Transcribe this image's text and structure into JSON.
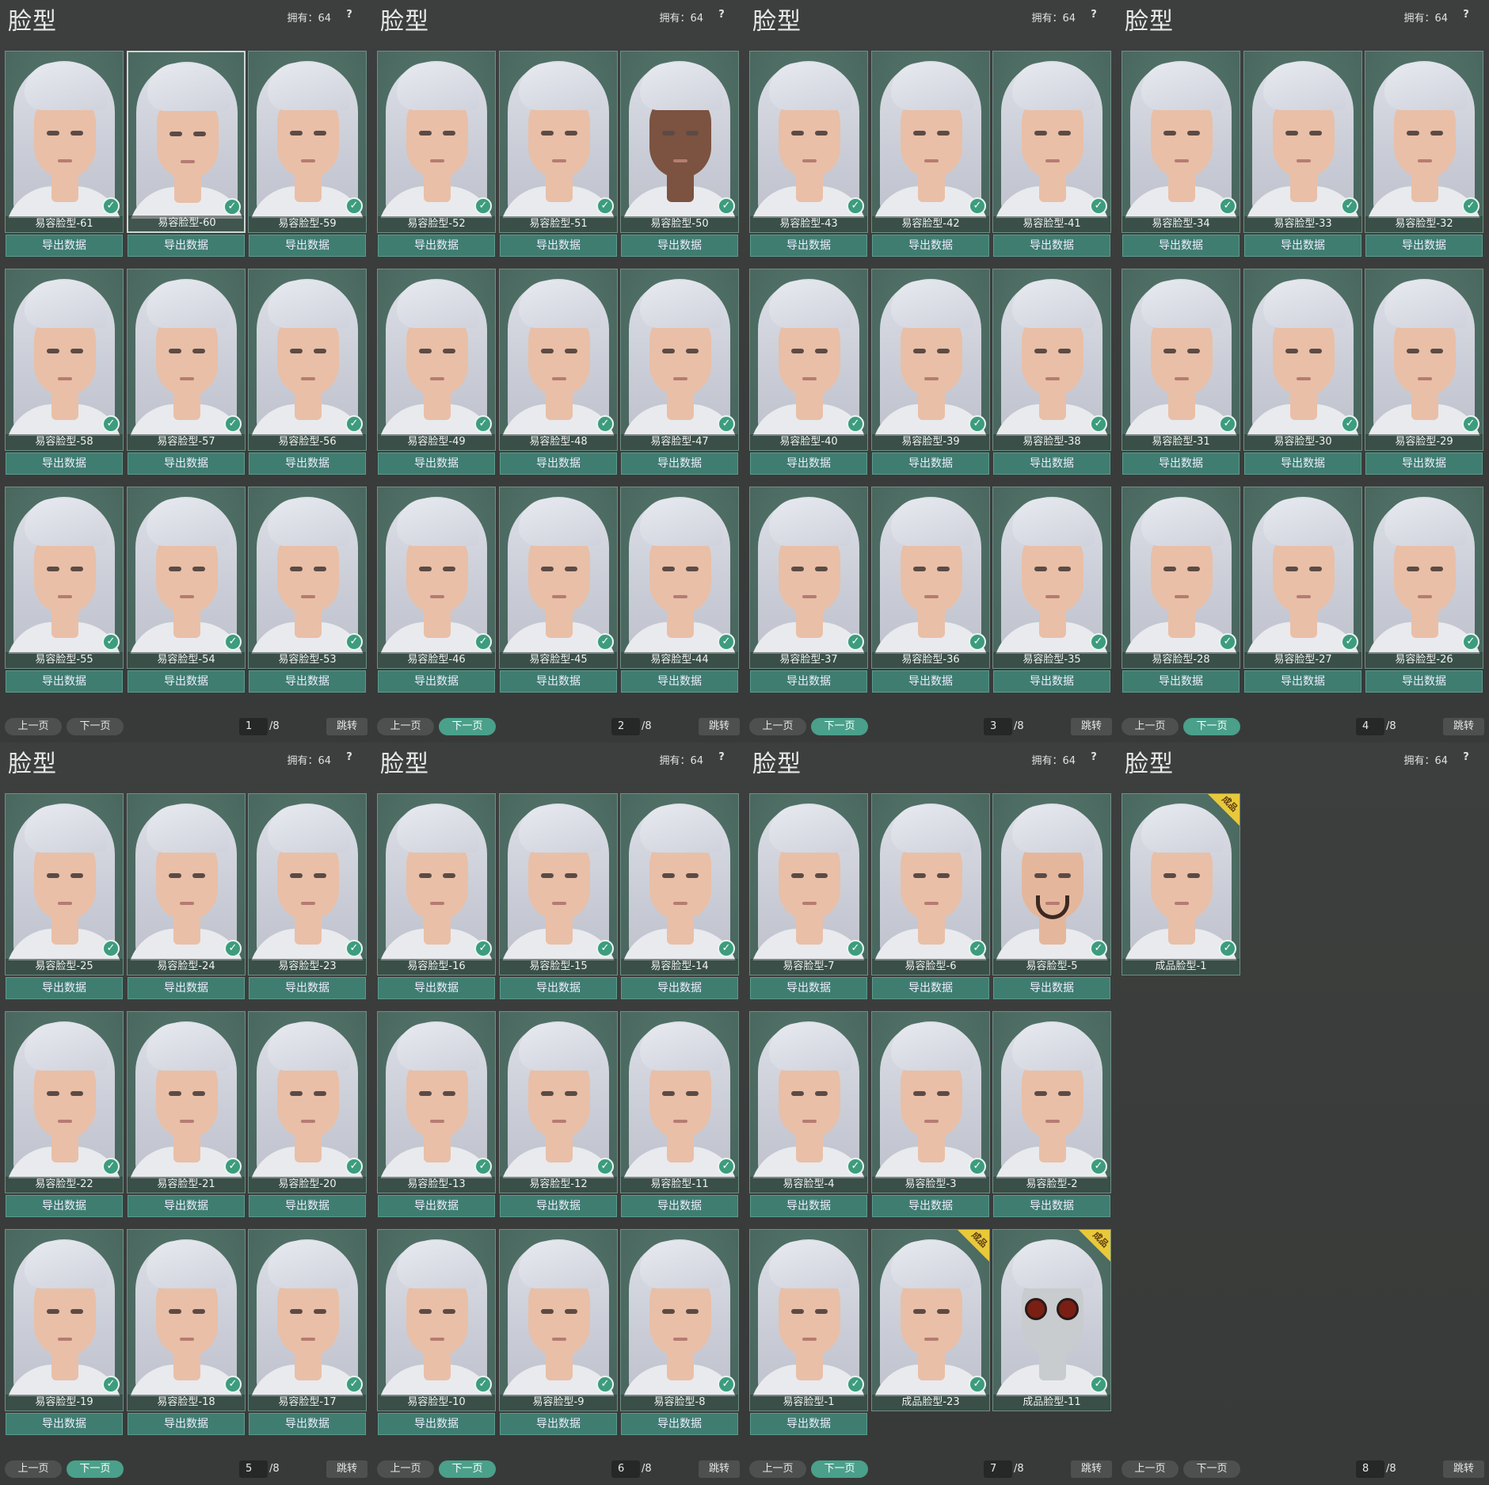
{
  "app": {
    "export_label": "导出数据",
    "prev_label": "上一页",
    "next_label": "下一页",
    "jump_label": "跳转",
    "owned_label": "拥有：64",
    "help_label": "?",
    "page_total": "/8",
    "badge_label": "成品",
    "check_glyph": "✓"
  },
  "colors": {
    "card_bg": "#4f6f65",
    "button_bg": "#3f7d70",
    "page_bg": "#3a3c3b",
    "accent": "#4aa08a",
    "badge": "#e8c93a"
  },
  "panels": [
    {
      "title": "脸型",
      "page": "1",
      "next_active": false,
      "cards": [
        {
          "label": "易容脸型-61",
          "selected": false,
          "tone": "light",
          "badge": false,
          "export": true
        },
        {
          "label": "易容脸型-60",
          "selected": true,
          "tone": "light",
          "badge": false,
          "export": true
        },
        {
          "label": "易容脸型-59",
          "selected": false,
          "tone": "light",
          "badge": false,
          "export": true
        },
        {
          "label": "易容脸型-58",
          "selected": false,
          "tone": "light",
          "badge": false,
          "export": true
        },
        {
          "label": "易容脸型-57",
          "selected": false,
          "tone": "light",
          "badge": false,
          "export": true
        },
        {
          "label": "易容脸型-56",
          "selected": false,
          "tone": "light",
          "badge": false,
          "export": true
        },
        {
          "label": "易容脸型-55",
          "selected": false,
          "tone": "light",
          "badge": false,
          "export": true
        },
        {
          "label": "易容脸型-54",
          "selected": false,
          "tone": "light",
          "badge": false,
          "export": true
        },
        {
          "label": "易容脸型-53",
          "selected": false,
          "tone": "light",
          "badge": false,
          "export": true
        }
      ]
    },
    {
      "title": "脸型",
      "page": "2",
      "next_active": true,
      "cards": [
        {
          "label": "易容脸型-52",
          "selected": false,
          "tone": "light",
          "badge": false,
          "export": true
        },
        {
          "label": "易容脸型-51",
          "selected": false,
          "tone": "light",
          "badge": false,
          "export": true
        },
        {
          "label": "易容脸型-50",
          "selected": false,
          "tone": "dark",
          "badge": false,
          "export": true
        },
        {
          "label": "易容脸型-49",
          "selected": false,
          "tone": "light",
          "badge": false,
          "export": true
        },
        {
          "label": "易容脸型-48",
          "selected": false,
          "tone": "light",
          "badge": false,
          "export": true
        },
        {
          "label": "易容脸型-47",
          "selected": false,
          "tone": "light",
          "badge": false,
          "export": true
        },
        {
          "label": "易容脸型-46",
          "selected": false,
          "tone": "light",
          "badge": false,
          "export": true
        },
        {
          "label": "易容脸型-45",
          "selected": false,
          "tone": "light",
          "badge": false,
          "export": true
        },
        {
          "label": "易容脸型-44",
          "selected": false,
          "tone": "light",
          "badge": false,
          "export": true
        }
      ]
    },
    {
      "title": "脸型",
      "page": "3",
      "next_active": true,
      "cards": [
        {
          "label": "易容脸型-43",
          "selected": false,
          "tone": "light",
          "badge": false,
          "export": true
        },
        {
          "label": "易容脸型-42",
          "selected": false,
          "tone": "light",
          "badge": false,
          "export": true
        },
        {
          "label": "易容脸型-41",
          "selected": false,
          "tone": "light",
          "badge": false,
          "export": true
        },
        {
          "label": "易容脸型-40",
          "selected": false,
          "tone": "light",
          "badge": false,
          "export": true
        },
        {
          "label": "易容脸型-39",
          "selected": false,
          "tone": "light",
          "badge": false,
          "export": true
        },
        {
          "label": "易容脸型-38",
          "selected": false,
          "tone": "light",
          "badge": false,
          "export": true
        },
        {
          "label": "易容脸型-37",
          "selected": false,
          "tone": "light",
          "badge": false,
          "export": true
        },
        {
          "label": "易容脸型-36",
          "selected": false,
          "tone": "light",
          "badge": false,
          "export": true
        },
        {
          "label": "易容脸型-35",
          "selected": false,
          "tone": "light",
          "badge": false,
          "export": true
        }
      ]
    },
    {
      "title": "脸型",
      "page": "4",
      "next_active": true,
      "cards": [
        {
          "label": "易容脸型-34",
          "selected": false,
          "tone": "light",
          "badge": false,
          "export": true
        },
        {
          "label": "易容脸型-33",
          "selected": false,
          "tone": "light",
          "badge": false,
          "export": true
        },
        {
          "label": "易容脸型-32",
          "selected": false,
          "tone": "light",
          "badge": false,
          "export": true
        },
        {
          "label": "易容脸型-31",
          "selected": false,
          "tone": "light",
          "badge": false,
          "export": true
        },
        {
          "label": "易容脸型-30",
          "selected": false,
          "tone": "light",
          "badge": false,
          "export": true
        },
        {
          "label": "易容脸型-29",
          "selected": false,
          "tone": "light",
          "badge": false,
          "export": true
        },
        {
          "label": "易容脸型-28",
          "selected": false,
          "tone": "light",
          "badge": false,
          "export": true
        },
        {
          "label": "易容脸型-27",
          "selected": false,
          "tone": "light",
          "badge": false,
          "export": true
        },
        {
          "label": "易容脸型-26",
          "selected": false,
          "tone": "light",
          "badge": false,
          "export": true
        }
      ]
    },
    {
      "title": "脸型",
      "page": "5",
      "next_active": true,
      "cards": [
        {
          "label": "易容脸型-25",
          "selected": false,
          "tone": "light",
          "badge": false,
          "export": true
        },
        {
          "label": "易容脸型-24",
          "selected": false,
          "tone": "light",
          "badge": false,
          "export": true
        },
        {
          "label": "易容脸型-23",
          "selected": false,
          "tone": "light",
          "badge": false,
          "export": true
        },
        {
          "label": "易容脸型-22",
          "selected": false,
          "tone": "light",
          "badge": false,
          "export": true
        },
        {
          "label": "易容脸型-21",
          "selected": false,
          "tone": "light",
          "badge": false,
          "export": true
        },
        {
          "label": "易容脸型-20",
          "selected": false,
          "tone": "light",
          "badge": false,
          "export": true
        },
        {
          "label": "易容脸型-19",
          "selected": false,
          "tone": "light",
          "badge": false,
          "export": true
        },
        {
          "label": "易容脸型-18",
          "selected": false,
          "tone": "light",
          "badge": false,
          "export": true
        },
        {
          "label": "易容脸型-17",
          "selected": false,
          "tone": "light",
          "badge": false,
          "export": true
        }
      ]
    },
    {
      "title": "脸型",
      "page": "6",
      "next_active": true,
      "cards": [
        {
          "label": "易容脸型-16",
          "selected": false,
          "tone": "light",
          "badge": false,
          "export": true
        },
        {
          "label": "易容脸型-15",
          "selected": false,
          "tone": "light",
          "badge": false,
          "export": true
        },
        {
          "label": "易容脸型-14",
          "selected": false,
          "tone": "light",
          "badge": false,
          "export": true
        },
        {
          "label": "易容脸型-13",
          "selected": false,
          "tone": "light",
          "badge": false,
          "export": true
        },
        {
          "label": "易容脸型-12",
          "selected": false,
          "tone": "light",
          "badge": false,
          "export": true
        },
        {
          "label": "易容脸型-11",
          "selected": false,
          "tone": "light",
          "badge": false,
          "export": true
        },
        {
          "label": "易容脸型-10",
          "selected": false,
          "tone": "light",
          "badge": false,
          "export": true
        },
        {
          "label": "易容脸型-9",
          "selected": false,
          "tone": "light",
          "badge": false,
          "export": true
        },
        {
          "label": "易容脸型-8",
          "selected": false,
          "tone": "light",
          "badge": false,
          "export": true
        }
      ]
    },
    {
      "title": "脸型",
      "page": "7",
      "next_active": true,
      "cards": [
        {
          "label": "易容脸型-7",
          "selected": false,
          "tone": "light",
          "badge": false,
          "export": true
        },
        {
          "label": "易容脸型-6",
          "selected": false,
          "tone": "light",
          "badge": false,
          "export": true
        },
        {
          "label": "易容脸型-5",
          "selected": false,
          "tone": "beard",
          "badge": false,
          "export": true
        },
        {
          "label": "易容脸型-4",
          "selected": false,
          "tone": "light",
          "badge": false,
          "export": true
        },
        {
          "label": "易容脸型-3",
          "selected": false,
          "tone": "light",
          "badge": false,
          "export": true
        },
        {
          "label": "易容脸型-2",
          "selected": false,
          "tone": "light",
          "badge": false,
          "export": true
        },
        {
          "label": "易容脸型-1",
          "selected": false,
          "tone": "light",
          "badge": false,
          "export": true
        },
        {
          "label": "成品脸型-23",
          "selected": false,
          "tone": "light",
          "badge": true,
          "export": false
        },
        {
          "label": "成品脸型-11",
          "selected": false,
          "tone": "mask",
          "badge": true,
          "export": false
        }
      ]
    },
    {
      "title": "脸型",
      "page": "8",
      "next_active": false,
      "cards": [
        {
          "label": "成品脸型-1",
          "selected": false,
          "tone": "light",
          "badge": true,
          "export": false
        }
      ]
    }
  ]
}
